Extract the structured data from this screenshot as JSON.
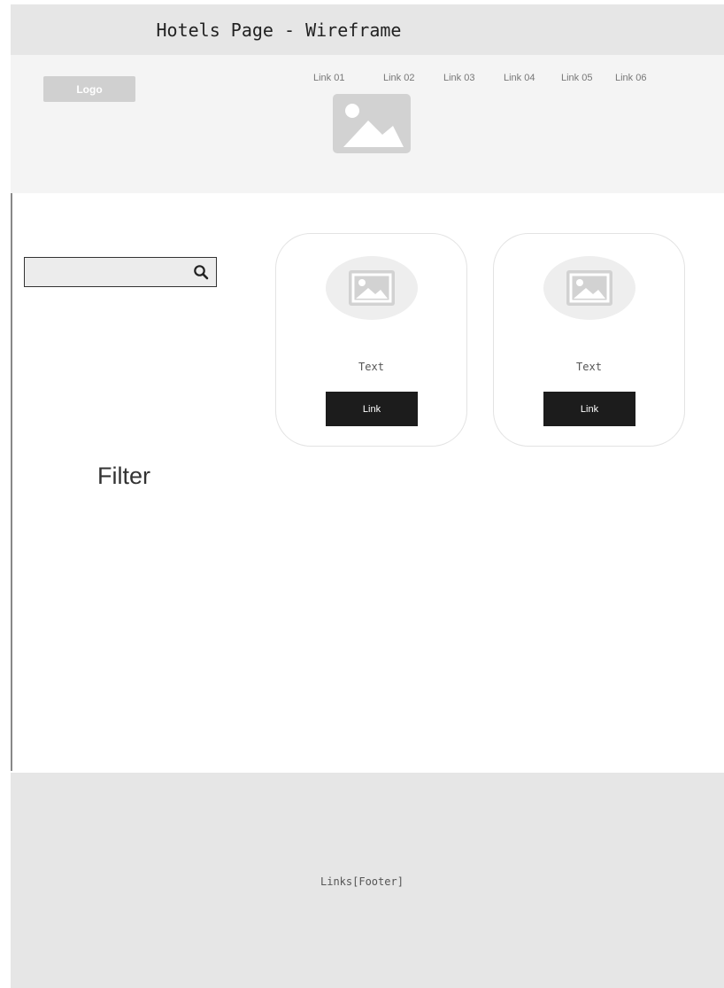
{
  "title": "Hotels Page - Wireframe",
  "header": {
    "logo_label": "Logo",
    "links": [
      "Link 01",
      "Link 02",
      "Link 03",
      "Link 04",
      "Link 05",
      "Link 06"
    ]
  },
  "sidebar": {
    "search_value": "",
    "filter_label": "Filter"
  },
  "cards": [
    {
      "text": "Text",
      "button_label": "Link"
    },
    {
      "text": "Text",
      "button_label": "Link"
    }
  ],
  "footer": {
    "text": "Links[Footer]"
  },
  "icons": {
    "search": "search-icon",
    "image": "image-placeholder-icon"
  },
  "colors": {
    "title_bar_bg": "#e6e6e6",
    "header_bg": "#f4f4f4",
    "button_bg": "#1c1c1c",
    "footer_bg": "#e6e6e6"
  }
}
